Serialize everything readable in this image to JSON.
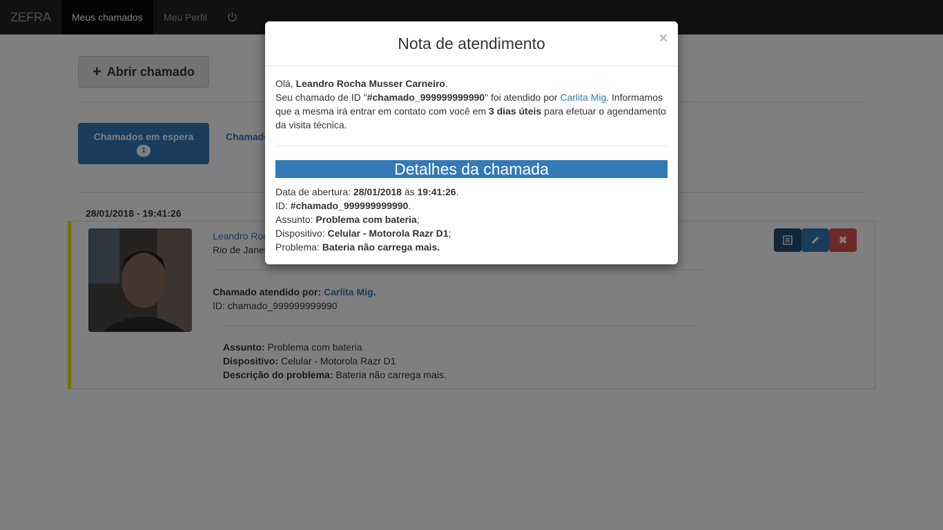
{
  "navbar": {
    "brand": "ZEFRA",
    "items": [
      {
        "label": "Meus chamados",
        "active": true
      },
      {
        "label": "Meu Perfil",
        "active": false
      }
    ],
    "power_icon": "power-icon"
  },
  "page": {
    "open_button_label": "Abrir chamado",
    "tabs": {
      "waiting_label": "Chamados em espera",
      "waiting_count": "1",
      "other_label_partial": "Chamado"
    },
    "date_heading": "28/01/2018 - 19:41:26",
    "card": {
      "name_partial": "Leandro Roc",
      "city_partial": "Rio de Janeir",
      "attended_label": "Chamado atendido por:",
      "attended_by": "Carlita Mig",
      "id_line": "ID: chamado_999999999990",
      "subject_label": "Assunto:",
      "subject_value": "Problema com bateria",
      "device_label": "Dispositivo:",
      "device_value": "Celular - Motorola Razr D1",
      "problem_label": "Descrição do problema:",
      "problem_value": "Bateria não carrega mais.",
      "accent_color": "#e8e000",
      "actions": [
        {
          "icon": "list-icon",
          "color": "#204d74"
        },
        {
          "icon": "pencil-icon",
          "color": "#337ab7"
        },
        {
          "icon": "close-icon",
          "color": "#d9534f"
        }
      ]
    }
  },
  "modal": {
    "title": "Nota de atendimento",
    "close": "×",
    "greeting": "Olá,",
    "user_name": "Leandro Rocha Musser Carneiro",
    "msg_1": "Seu chamado de ID \"",
    "ticket_id": "#chamado_999999999990",
    "msg_2": "\" foi atendido por ",
    "agent": "Carlita Mig",
    "msg_3": ". Informamos que a mesma irá entrar em contato com você em ",
    "days": "3 dias úteis",
    "msg_4": " para efetuar o agendamento da visita técnica.",
    "details_title": "Detalhes da chamada",
    "details": {
      "opened_label": "Data de abertura:",
      "opened_date": "28/01/2018",
      "opened_at": "às",
      "opened_time": "19:41:26",
      "id_label": "ID:",
      "id_value": "#chamado_999999999990",
      "subject_label": "Assunto:",
      "subject_value": "Problema com bateria",
      "device_label": "Dispositivo:",
      "device_value": "Celular - Motorola Razr D1",
      "problem_label": "Problema:",
      "problem_value": "Bateria não carrega mais."
    },
    "band_color": "#337ab7"
  }
}
